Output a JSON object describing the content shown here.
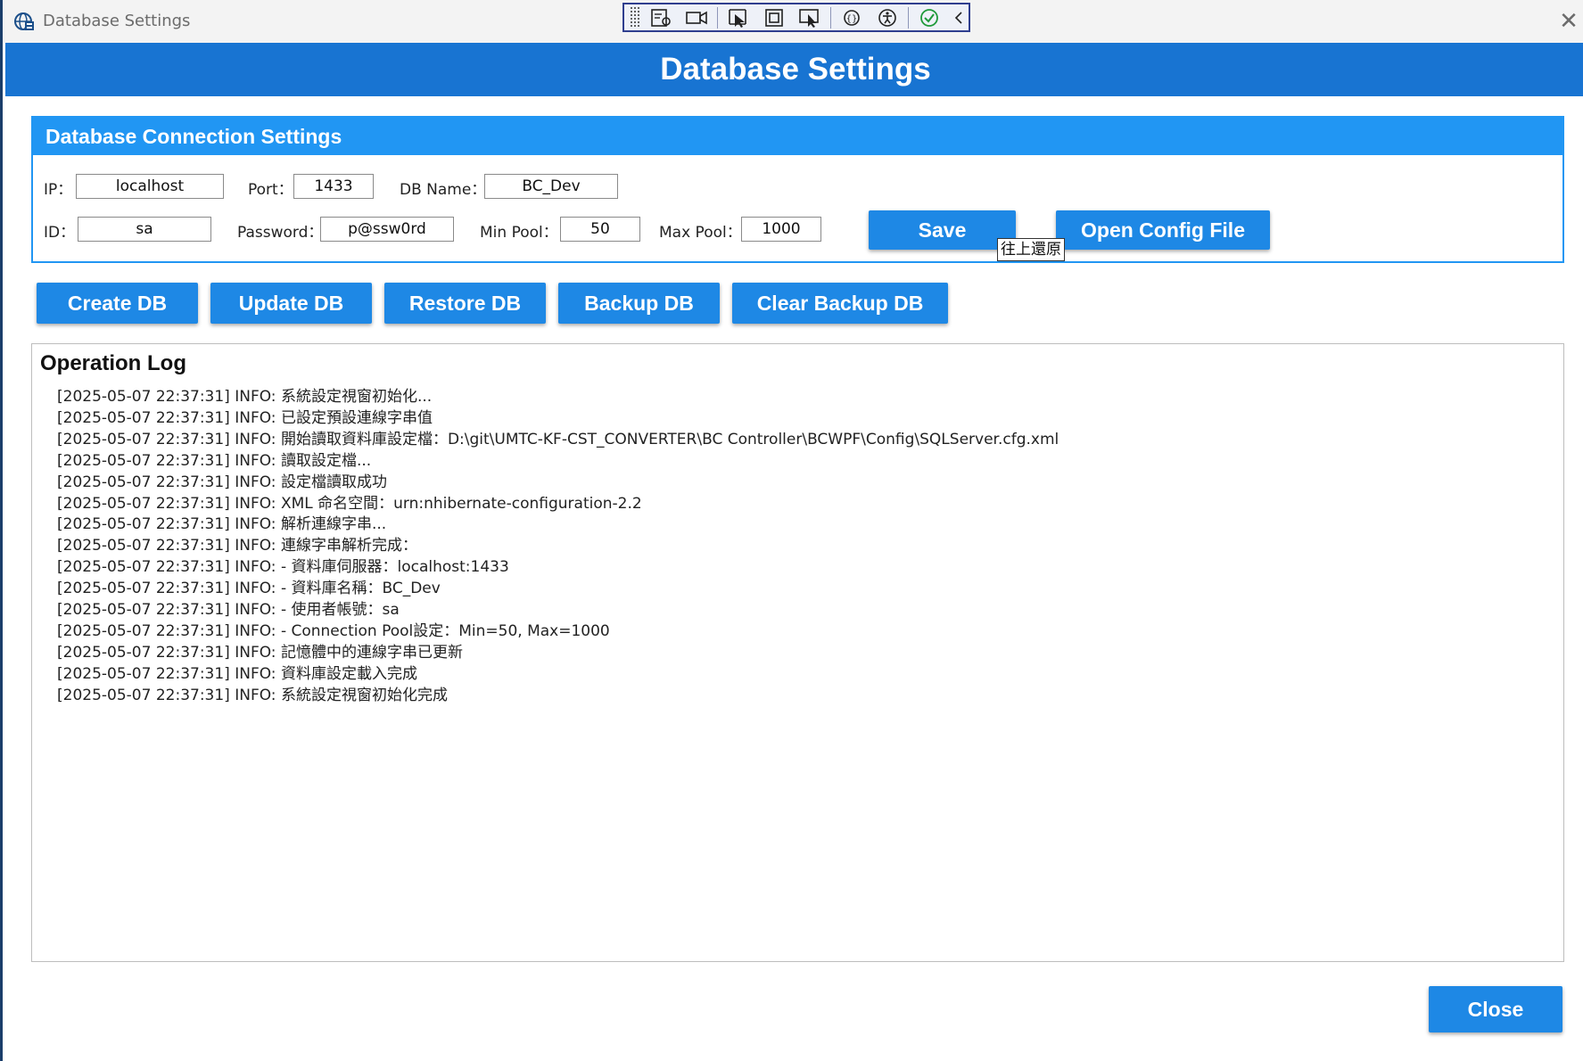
{
  "window": {
    "title": "Database Settings"
  },
  "header": {
    "title": "Database Settings"
  },
  "connection": {
    "section_title": "Database Connection Settings",
    "ip_label": "IP：",
    "ip_value": "localhost",
    "port_label": "Port：",
    "port_value": "1433",
    "dbname_label": "DB Name：",
    "dbname_value": "BC_Dev",
    "id_label": "ID：",
    "id_value": "sa",
    "password_label": "Password：",
    "password_value": "p@ssw0rd",
    "minpool_label": "Min Pool：",
    "minpool_value": "50",
    "maxpool_label": "Max Pool：",
    "maxpool_value": "1000",
    "save_label": "Save",
    "open_config_label": "Open Config File",
    "tooltip": "往上還原"
  },
  "actions": {
    "create_db": "Create DB",
    "update_db": "Update DB",
    "restore_db": "Restore DB",
    "backup_db": "Backup DB",
    "clear_backup_db": "Clear Backup DB"
  },
  "log": {
    "title": "Operation Log",
    "entries": [
      "[2025-05-07 22:37:31] INFO: 系統設定視窗初始化...",
      "[2025-05-07 22:37:31] INFO: 已設定預設連線字串值",
      "[2025-05-07 22:37:31] INFO: 開始讀取資料庫設定檔：D:\\git\\UMTC-KF-CST_CONVERTER\\BC Controller\\BCWPF\\Config\\SQLServer.cfg.xml",
      "[2025-05-07 22:37:31] INFO: 讀取設定檔...",
      "[2025-05-07 22:37:31] INFO: 設定檔讀取成功",
      "[2025-05-07 22:37:31] INFO: XML 命名空間：urn:nhibernate-configuration-2.2",
      "[2025-05-07 22:37:31] INFO: 解析連線字串...",
      "[2025-05-07 22:37:31] INFO: 連線字串解析完成：",
      "[2025-05-07 22:37:31] INFO: - 資料庫伺服器：localhost:1433",
      "[2025-05-07 22:37:31] INFO: - 資料庫名稱：BC_Dev",
      "[2025-05-07 22:37:31] INFO: - 使用者帳號：sa",
      "[2025-05-07 22:37:31] INFO: - Connection Pool設定：Min=50, Max=1000",
      "[2025-05-07 22:37:31] INFO: 記憶體中的連線字串已更新",
      "[2025-05-07 22:37:31] INFO: 資料庫設定載入完成",
      "[2025-05-07 22:37:31] INFO: 系統設定視窗初始化完成"
    ]
  },
  "footer": {
    "close_label": "Close"
  },
  "colors": {
    "header_blue": "#1874d2",
    "panel_blue": "#2196f3",
    "button_blue": "#1e88e5"
  },
  "icons": [
    "app-globe-icon",
    "close-icon",
    "inspect-icon",
    "record-icon",
    "select-element-icon",
    "frame-icon",
    "track-icon",
    "binding-icon",
    "accessibility-icon",
    "check-icon",
    "collapse-icon"
  ]
}
